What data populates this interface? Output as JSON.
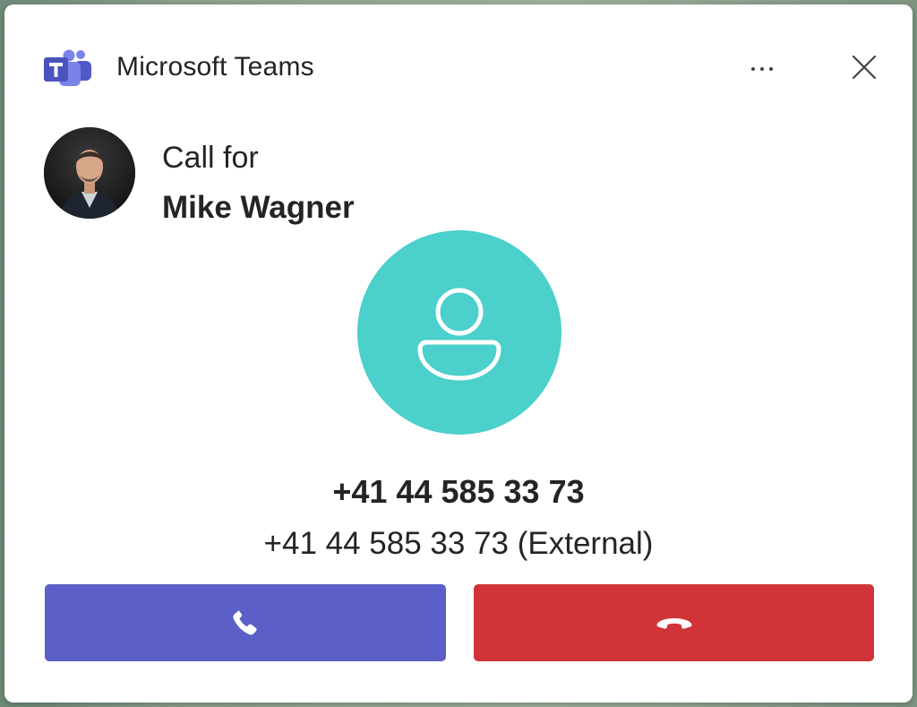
{
  "app": {
    "title": "Microsoft Teams",
    "logo_icon": "teams-logo",
    "more_icon": "more-options-icon",
    "close_icon": "close-icon"
  },
  "call": {
    "call_for_label": "Call for",
    "callee_name": "Mike Wagner",
    "caller_number": "+41 44 585 33 73",
    "caller_detail": "+41 44 585 33 73 (External)"
  },
  "actions": {
    "accept_icon": "phone-icon",
    "decline_icon": "phone-hangup-icon"
  },
  "colors": {
    "accept": "#5b5fc7",
    "decline": "#d13438",
    "caller_avatar": "#4bd0cb",
    "brand": "#5b5fc7"
  }
}
